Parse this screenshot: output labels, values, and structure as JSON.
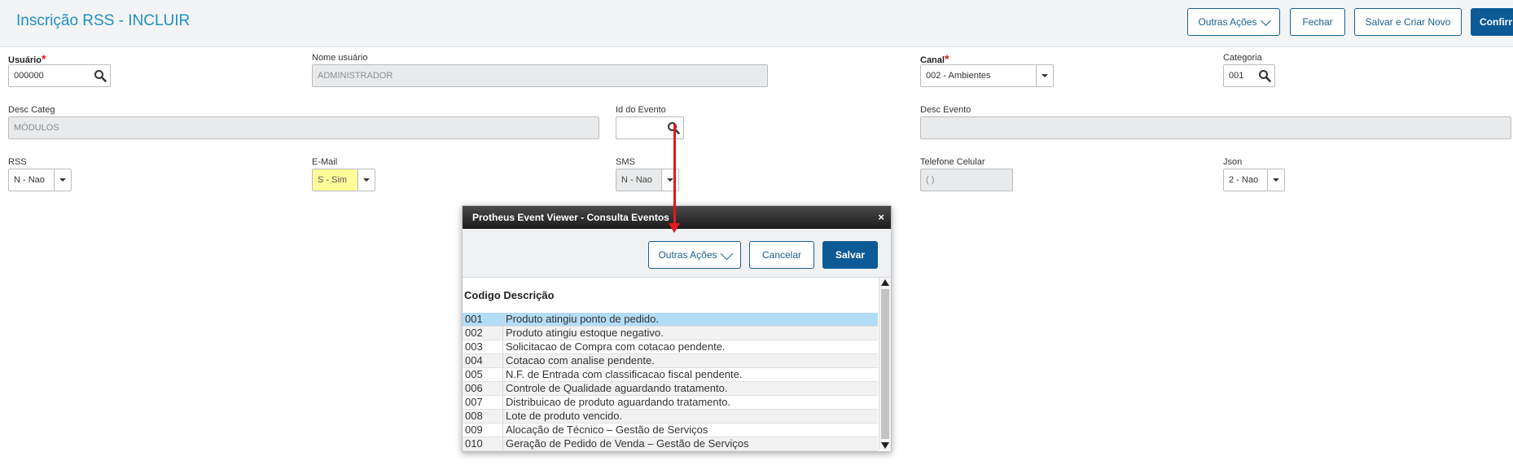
{
  "header": {
    "title": "Inscrição RSS - INCLUIR",
    "buttons": {
      "other_actions": "Outras Ações",
      "close": "Fechar",
      "save_new": "Salvar e Criar Novo",
      "confirm": "Confirmar"
    }
  },
  "form": {
    "usuario": {
      "label": "Usuário",
      "required_mark": "*",
      "value": "000000"
    },
    "nome_usuario": {
      "label": "Nome usuário",
      "value": "ADMINISTRADOR"
    },
    "canal": {
      "label": "Canal",
      "required_mark": "*",
      "value": "002 - Ambientes"
    },
    "categoria": {
      "label": "Categoria",
      "value": "001"
    },
    "desc_categ": {
      "label": "Desc Categ",
      "value": "MÓDULOS"
    },
    "id_evento": {
      "label": "Id do Evento",
      "value": ""
    },
    "desc_evento": {
      "label": "Desc Evento",
      "value": ""
    },
    "rss": {
      "label": "RSS",
      "value": "N - Nao"
    },
    "email": {
      "label": "E-Mail",
      "value": "S - Sim"
    },
    "sms": {
      "label": "SMS",
      "value": "N - Nao"
    },
    "telefone": {
      "label": "Telefone Celular",
      "value": "(  )"
    },
    "json": {
      "label": "Json",
      "value": "2 - Nao"
    }
  },
  "dialog": {
    "title": "Protheus Event Viewer - Consulta Eventos",
    "close": "×",
    "buttons": {
      "other_actions": "Outras Ações",
      "cancel": "Cancelar",
      "save": "Salvar"
    },
    "columns": [
      "Codigo",
      "Descrição"
    ],
    "rows": [
      {
        "code": "001",
        "desc": "Produto atingiu ponto de pedido."
      },
      {
        "code": "002",
        "desc": "Produto atingiu estoque negativo."
      },
      {
        "code": "003",
        "desc": "Solicitacao de Compra com cotacao pendente."
      },
      {
        "code": "004",
        "desc": "Cotacao com analise pendente."
      },
      {
        "code": "005",
        "desc": "N.F. de Entrada com classificacao fiscal pendente."
      },
      {
        "code": "006",
        "desc": "Controle de Qualidade aguardando tratamento."
      },
      {
        "code": "007",
        "desc": "Distribuicao de produto aguardando tratamento."
      },
      {
        "code": "008",
        "desc": "Lote de produto vencido."
      },
      {
        "code": "009",
        "desc": "Alocação de Técnico – Gestão de Serviços"
      },
      {
        "code": "010",
        "desc": "Geração de Pedido de Venda – Gestão de Serviços"
      }
    ],
    "selected_index": 0
  },
  "colors": {
    "accent": "#1e8fbf",
    "primary_button": "#0c5b97",
    "annotation_arrow": "#e01b1b",
    "selected_row": "#b3dcf6",
    "highlight": "#ffff99"
  }
}
